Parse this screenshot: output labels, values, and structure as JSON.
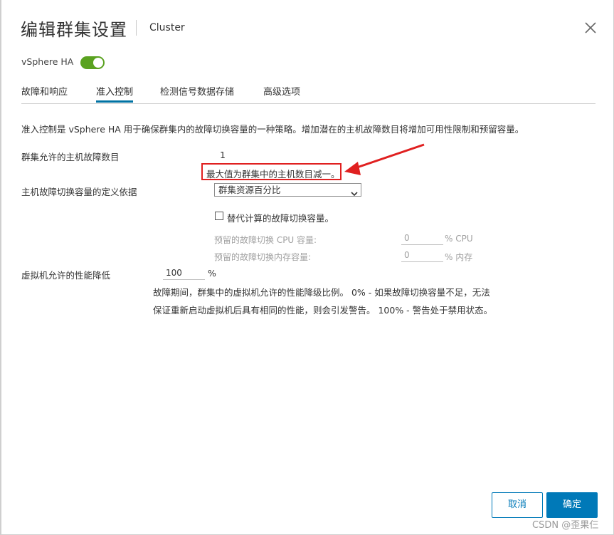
{
  "dialog": {
    "title": "编辑群集设置",
    "subtitle": "Cluster"
  },
  "ha": {
    "label": "vSphere HA",
    "enabled": true
  },
  "tabs": [
    {
      "label": "故障和响应",
      "active": false
    },
    {
      "label": "准入控制",
      "active": true
    },
    {
      "label": "检测信号数据存储",
      "active": false
    },
    {
      "label": "高级选项",
      "active": false
    }
  ],
  "admission": {
    "description": "准入控制是 vSphere HA 用于确保群集内的故障切换容量的一种策略。增加潜在的主机故障数目将增加可用性限制和预留容量。",
    "host_failures_label": "群集允许的主机故障数目",
    "host_failures_value": "1",
    "host_failures_hint": "最大值为群集中的主机数目减一。",
    "capacity_basis_label": "主机故障切换容量的定义依据",
    "capacity_basis_selected": "群集资源百分比",
    "override_checkbox_label": "替代计算的故障切换容量。",
    "override_checked": false,
    "cpu_reserved_label": "预留的故障切换 CPU 容量:",
    "cpu_reserved_value": "0",
    "cpu_reserved_unit": "% CPU",
    "mem_reserved_label": "预留的故障切换内存容量:",
    "mem_reserved_value": "0",
    "mem_reserved_unit": "% 内存",
    "perf_label": "虚拟机允许的性能降低",
    "perf_value": "100",
    "perf_unit": "%",
    "perf_help_line1": "故障期间，群集中的虚拟机允许的性能降级比例。 0% - 如果故障切换容量不足，无法",
    "perf_help_line2": "保证重新启动虚拟机后具有相同的性能，则会引发警告。 100% - 警告处于禁用状态。"
  },
  "footer": {
    "cancel_label": "取消",
    "ok_label": "确定"
  },
  "watermark": "CSDN @歪果仨",
  "colors": {
    "accent": "#0079b8",
    "toggle_on": "#5aa220",
    "highlight": "#e02020"
  }
}
